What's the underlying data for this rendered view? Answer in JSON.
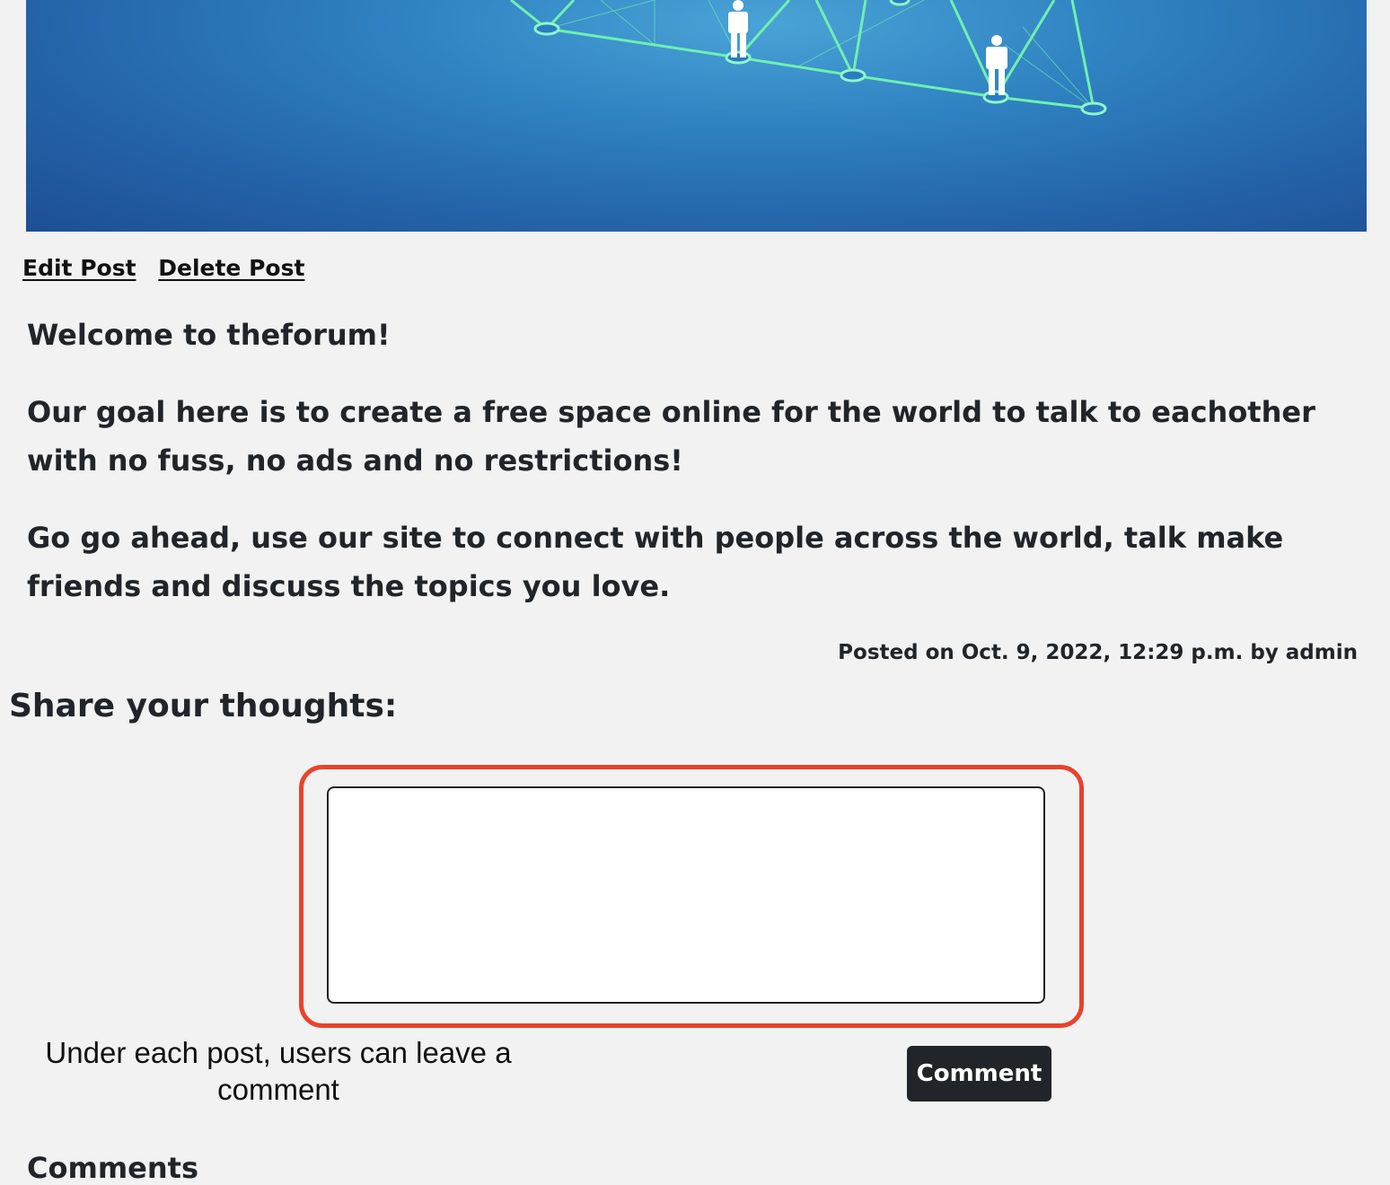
{
  "post": {
    "edit_label": "Edit Post",
    "delete_label": "Delete Post",
    "paragraphs": [
      "Welcome to theforum!",
      "Our goal here is to create a free space online for the world to talk to eachother with no fuss, no ads and no restrictions!",
      "Go go ahead, use our site to connect with people across the world, talk make friends and discuss the topics you love."
    ],
    "meta": "Posted on Oct. 9, 2022, 12:29 p.m. by admin"
  },
  "comment_form": {
    "title": "Share your thoughts:",
    "textarea_value": "",
    "button_label": "Comment"
  },
  "annotation": {
    "text": "Under each post, users can leave a comment",
    "highlight_color": "#e8432c"
  },
  "comments": {
    "heading": "Comments"
  },
  "hero": {
    "icon": "network-people-icon"
  },
  "colors": {
    "background": "#f2f2f2",
    "button": "#212529",
    "hero_blue": "#2f82c1",
    "network_lines": "#6ff0b0"
  }
}
